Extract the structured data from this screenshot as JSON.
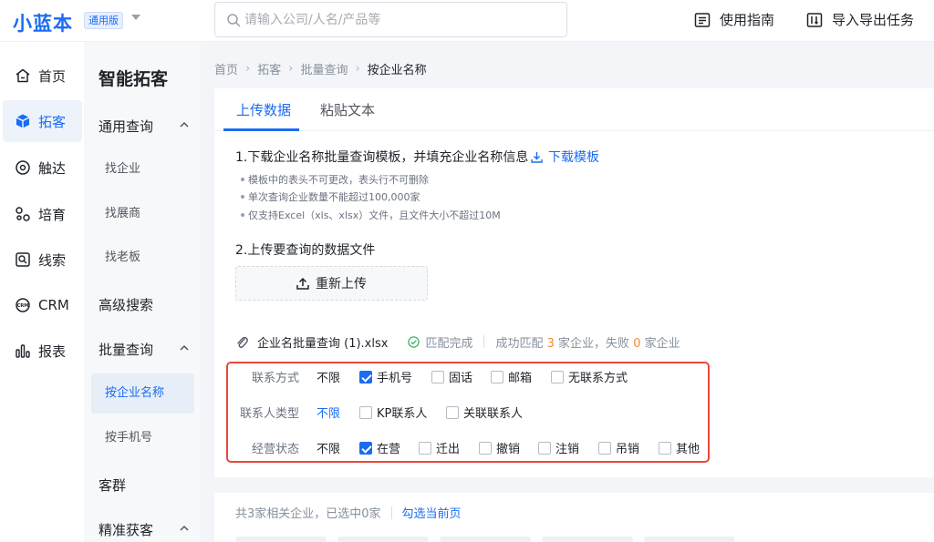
{
  "header": {
    "logo": "小蓝本",
    "edition": "通用版",
    "search_placeholder": "请输入公司/人名/产品等",
    "guide_label": "使用指南",
    "tasks_label": "导入导出任务"
  },
  "nav": {
    "items": [
      {
        "label": "首页",
        "icon": "home-icon"
      },
      {
        "label": "拓客",
        "icon": "cube-icon"
      },
      {
        "label": "触达",
        "icon": "target-icon"
      },
      {
        "label": "培育",
        "icon": "nurture-icon"
      },
      {
        "label": "线索",
        "icon": "clue-icon"
      },
      {
        "label": "CRM",
        "icon": "crm-icon"
      },
      {
        "label": "报表",
        "icon": "chart-bars-icon"
      }
    ],
    "active_index": 1
  },
  "subnav": {
    "title": "智能拓客",
    "group_general": "通用查询",
    "find_company": "找企业",
    "find_exhibitor": "找展商",
    "find_boss": "找老板",
    "advanced_search": "高级搜索",
    "group_batch": "批量查询",
    "by_company_name": "按企业名称",
    "by_phone": "按手机号",
    "customer_group": "客群",
    "precise_acquire": "精准获客"
  },
  "breadcrumb": {
    "home": "首页",
    "tuoke": "拓客",
    "batch": "批量查询",
    "current": "按企业名称"
  },
  "tabs": {
    "upload": "上传数据",
    "paste": "粘贴文本"
  },
  "upload_panel": {
    "step1": "1.下载企业名称批量查询模板，并填充企业名称信息",
    "download_template": "下载模板",
    "bullets": [
      "模板中的表头不可更改，表头行不可删除",
      "单次查询企业数量不能超过100,000家",
      "仅支持Excel（xls、xlsx）文件，且文件大小不超过10M"
    ],
    "step2": "2.上传要查询的数据文件",
    "reupload": "重新上传",
    "file_name": "企业名批量查询 (1).xlsx",
    "match_status": "匹配完成",
    "result_prefix": "成功匹配",
    "success_count": "3",
    "result_mid": "家企业，失败",
    "fail_count": "0",
    "result_suffix": "家企业"
  },
  "filters": {
    "contact_method": {
      "label": "联系方式",
      "unlimited": "不限",
      "options": [
        {
          "label": "手机号",
          "checked": true
        },
        {
          "label": "固话",
          "checked": false
        },
        {
          "label": "邮箱",
          "checked": false
        },
        {
          "label": "无联系方式",
          "checked": false
        }
      ]
    },
    "contact_type": {
      "label": "联系人类型",
      "unlimited": "不限",
      "options": [
        {
          "label": "KP联系人",
          "checked": false
        },
        {
          "label": "关联联系人",
          "checked": false
        }
      ]
    },
    "business_status": {
      "label": "经营状态",
      "unlimited": "不限",
      "options": [
        {
          "label": "在营",
          "checked": true
        },
        {
          "label": "迁出",
          "checked": false
        },
        {
          "label": "撤销",
          "checked": false
        },
        {
          "label": "注销",
          "checked": false
        },
        {
          "label": "吊销",
          "checked": false
        },
        {
          "label": "其他",
          "checked": false
        }
      ]
    }
  },
  "list": {
    "summary": "共3家相关企业，已选中0家",
    "select_page": "勾选当前页"
  },
  "colors": {
    "accent": "#1a6cf3",
    "highlight_border": "#e8473a",
    "count_orange": "#f08c2c",
    "success_green": "#43b36a"
  }
}
